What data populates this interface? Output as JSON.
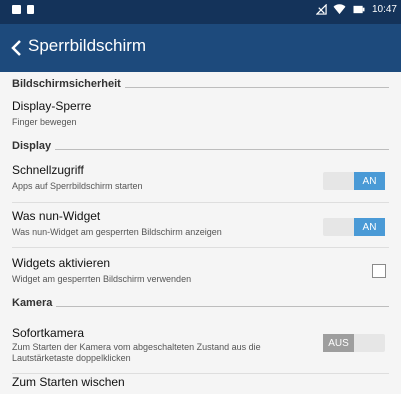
{
  "status_bar": {
    "time": "10:47",
    "left_icons": [
      "message-icon",
      "sd-card-icon"
    ],
    "right_icons": [
      "signal-icon",
      "wifi-icon",
      "battery-charging-icon"
    ]
  },
  "app_bar": {
    "title": "Sperrbildschirm",
    "back_icon": "chevron-left-icon"
  },
  "sections": [
    {
      "label": "Bildschirmsicherheit"
    },
    {
      "label": "Display"
    },
    {
      "label": "Kamera"
    }
  ],
  "items": [
    {
      "title": "Display-Sperre",
      "subtitle": "Finger bewegen"
    },
    {
      "title": "Schnellzugriff",
      "subtitle": "Apps auf Sperrbildschirm starten",
      "control": "toggle",
      "state": "AN"
    },
    {
      "title": "Was nun-Widget",
      "subtitle": "Was nun-Widget am gesperrten Bildschirm anzeigen",
      "control": "toggle",
      "state": "AN"
    },
    {
      "title": "Widgets aktivieren",
      "subtitle": "Widget am gesperrten Bildschirm verwenden",
      "control": "checkbox",
      "checked": false
    },
    {
      "title": "Sofortkamera",
      "subtitle_lines": [
        "Zum Starten der Kamera vom abgeschalteten Zustand aus die",
        "Lautstärketaste doppelklicken"
      ],
      "control": "toggle",
      "state": "AUS"
    },
    {
      "title": "Zum Starten wischen"
    }
  ],
  "colors": {
    "status_bar": "#14335a",
    "app_bar": "#1d4a7c",
    "toggle_on": "#4a9ad6",
    "toggle_off": "#9e9e9e"
  }
}
